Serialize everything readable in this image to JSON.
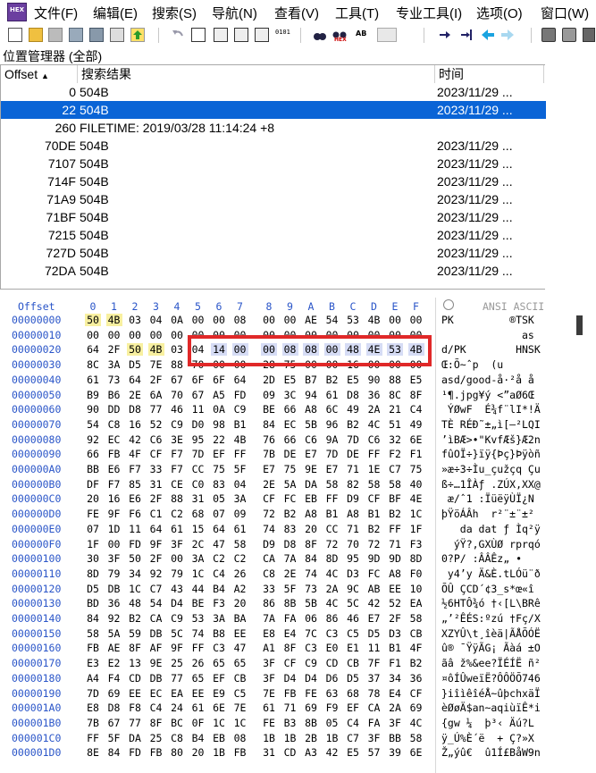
{
  "menu": {
    "items": [
      "文件(F)",
      "编辑(E)",
      "搜索(S)",
      "导航(N)",
      "查看(V)",
      "工具(T)",
      "专业工具(I)",
      "选项(O)",
      "窗口(W)"
    ]
  },
  "toolbar": {
    "icons": [
      "new-file-icon",
      "open-folder-icon",
      "save-icon",
      "print-icon",
      "print-preview-icon",
      "properties-icon",
      "export-icon",
      "undo-icon",
      "copy-icon",
      "copy-block-icon",
      "paste-icon",
      "paste-write-icon",
      "binary-icon",
      "find-icon",
      "find-hex-icon",
      "replace-icon",
      "find-hex-next-icon",
      "goto-icon",
      "goto-offset-icon",
      "back-icon",
      "forward-icon",
      "disk-icon",
      "disk-write-icon",
      "tool-icon"
    ],
    "labels": {
      "hex1": "HEX",
      "hex2": "HEX",
      "ab": "AB",
      "bin": "0101"
    }
  },
  "position_manager": {
    "title": "位置管理器 (全部)",
    "columns": {
      "offset": "Offset",
      "result": "搜索结果",
      "time": "时间"
    },
    "sort_arrow": "▲",
    "rows": [
      {
        "offset": "0",
        "result": "504B",
        "time": "2023/11/29 ..."
      },
      {
        "offset": "22",
        "result": "504B",
        "time": "2023/11/29 ..."
      },
      {
        "offset": "260",
        "result": "FILETIME: 2019/03/28  11:14:24  +8",
        "time": ""
      },
      {
        "offset": "70DE",
        "result": "504B",
        "time": "2023/11/29 ..."
      },
      {
        "offset": "7107",
        "result": "504B",
        "time": "2023/11/29 ..."
      },
      {
        "offset": "714F",
        "result": "504B",
        "time": "2023/11/29 ..."
      },
      {
        "offset": "71A9",
        "result": "504B",
        "time": "2023/11/29 ..."
      },
      {
        "offset": "71BF",
        "result": "504B",
        "time": "2023/11/29 ..."
      },
      {
        "offset": "7215",
        "result": "504B",
        "time": "2023/11/29 ..."
      },
      {
        "offset": "727D",
        "result": "504B",
        "time": "2023/11/29 ..."
      },
      {
        "offset": "72DA",
        "result": "504B",
        "time": "2023/11/29 ..."
      }
    ],
    "selected_row": 1
  },
  "hex": {
    "offset_header": "Offset",
    "column_headers": [
      "0",
      "1",
      "2",
      "3",
      "4",
      "5",
      "6",
      "7",
      "8",
      "9",
      "A",
      "B",
      "C",
      "D",
      "E",
      "F"
    ],
    "ansi_header": "ANSI ASCII",
    "rows": [
      {
        "offset": "00000000",
        "bytes": [
          "50",
          "4B",
          "03",
          "04",
          "0A",
          "00",
          "00",
          "08",
          "00",
          "00",
          "AE",
          "54",
          "53",
          "4B",
          "00",
          "00"
        ],
        "ansi": "PK         ®TSK"
      },
      {
        "offset": "00000010",
        "bytes": [
          "00",
          "00",
          "00",
          "00",
          "00",
          "00",
          "00",
          "00",
          "00",
          "00",
          "00",
          "00",
          "00",
          "00",
          "00",
          "00"
        ],
        "ansi": "             as"
      },
      {
        "offset": "00000020",
        "bytes": [
          "64",
          "2F",
          "50",
          "4B",
          "03",
          "04",
          "14",
          "00",
          "00",
          "08",
          "08",
          "00",
          "48",
          "4E",
          "53",
          "4B"
        ],
        "ansi": "d/PK        HNSK"
      },
      {
        "offset": "00000030",
        "bytes": [
          "8C",
          "3A",
          "D5",
          "7E",
          "88",
          "70",
          "00",
          "00",
          "28",
          "75",
          "00",
          "00",
          "16",
          "00",
          "00",
          "00"
        ],
        "ansi": "Œ:Õ~ˆp  (u"
      },
      {
        "offset": "00000040",
        "bytes": [
          "61",
          "73",
          "64",
          "2F",
          "67",
          "6F",
          "6F",
          "64",
          "2D",
          "E5",
          "B7",
          "B2",
          "E5",
          "90",
          "88",
          "E5"
        ],
        "ansi": "asd/good-å·²å å"
      },
      {
        "offset": "00000050",
        "bytes": [
          "B9",
          "B6",
          "2E",
          "6A",
          "70",
          "67",
          "A5",
          "FD",
          "09",
          "3C",
          "94",
          "61",
          "D8",
          "36",
          "8C",
          "8F"
        ],
        "ansi": "¹¶.jpg¥ý <”aØ6Œ"
      },
      {
        "offset": "00000060",
        "bytes": [
          "90",
          "DD",
          "D8",
          "77",
          "46",
          "11",
          "0A",
          "C9",
          "BE",
          "66",
          "A8",
          "6C",
          "49",
          "2A",
          "21",
          "C4"
        ],
        "ansi": " ÝØwF  É¾f¨lI*!Ä"
      },
      {
        "offset": "00000070",
        "bytes": [
          "54",
          "C8",
          "16",
          "52",
          "C9",
          "D0",
          "98",
          "B1",
          "84",
          "EC",
          "5B",
          "96",
          "B2",
          "4C",
          "51",
          "49"
        ],
        "ansi": "TÈ RÉÐ˜±„ì[–²LQI"
      },
      {
        "offset": "00000080",
        "bytes": [
          "92",
          "EC",
          "42",
          "C6",
          "3E",
          "95",
          "22",
          "4B",
          "76",
          "66",
          "C6",
          "9A",
          "7D",
          "C6",
          "32",
          "6E"
        ],
        "ansi": "’ìBÆ>•\"KvfÆš}Æ2n"
      },
      {
        "offset": "00000090",
        "bytes": [
          "66",
          "FB",
          "4F",
          "CF",
          "F7",
          "7D",
          "EF",
          "FF",
          "7B",
          "DE",
          "E7",
          "7D",
          "DE",
          "FF",
          "F2",
          "F1"
        ],
        "ansi": "fûOÏ÷}ïÿ{Þç}Þÿòñ"
      },
      {
        "offset": "000000A0",
        "bytes": [
          "BB",
          "E6",
          "F7",
          "33",
          "F7",
          "CC",
          "75",
          "5F",
          "E7",
          "75",
          "9E",
          "E7",
          "71",
          "1E",
          "C7",
          "75"
        ],
        "ansi": "»æ÷3÷Ìu_çužçq Çu"
      },
      {
        "offset": "000000B0",
        "bytes": [
          "DF",
          "F7",
          "85",
          "31",
          "CE",
          "C0",
          "83",
          "04",
          "2E",
          "5A",
          "DA",
          "58",
          "82",
          "58",
          "58",
          "40"
        ],
        "ansi": "ß÷…1ÎÀƒ .ZÚX‚XX@"
      },
      {
        "offset": "000000C0",
        "bytes": [
          "20",
          "16",
          "E6",
          "2F",
          "88",
          "31",
          "05",
          "3A",
          "CF",
          "FC",
          "EB",
          "FF",
          "D9",
          "CF",
          "BF",
          "4E"
        ],
        "ansi": " æ/ˆ1 :ÏüëÿÙÏ¿N"
      },
      {
        "offset": "000000D0",
        "bytes": [
          "FE",
          "9F",
          "F6",
          "C1",
          "C2",
          "68",
          "07",
          "09",
          "72",
          "B2",
          "A8",
          "B1",
          "A8",
          "B1",
          "B2",
          "1C"
        ],
        "ansi": "þŸöÁÂh  r²¨±¨±² "
      },
      {
        "offset": "000000E0",
        "bytes": [
          "07",
          "1D",
          "11",
          "64",
          "61",
          "15",
          "64",
          "61",
          "74",
          "83",
          "20",
          "CC",
          "71",
          "B2",
          "FF",
          "1F"
        ],
        "ansi": "   da dat ƒ Ìq²ÿ "
      },
      {
        "offset": "000000F0",
        "bytes": [
          "1F",
          "00",
          "FD",
          "9F",
          "3F",
          "2C",
          "47",
          "58",
          "D9",
          "D8",
          "8F",
          "72",
          "70",
          "72",
          "71",
          "F3"
        ],
        "ansi": "  ýŸ?,GXÙØ rprqó"
      },
      {
        "offset": "00000100",
        "bytes": [
          "30",
          "3F",
          "50",
          "2F",
          "00",
          "3A",
          "C2",
          "C2",
          "CA",
          "7A",
          "84",
          "8D",
          "95",
          "9D",
          "9D",
          "8D"
        ],
        "ansi": "0?P/ :ÂÂÊz„ •  "
      },
      {
        "offset": "00000110",
        "bytes": [
          "8D",
          "79",
          "34",
          "92",
          "79",
          "1C",
          "C4",
          "26",
          "C8",
          "2E",
          "74",
          "4C",
          "D3",
          "FC",
          "A8",
          "F0"
        ],
        "ansi": " y4’y Ä&È.tLÓü¨ð"
      },
      {
        "offset": "00000120",
        "bytes": [
          "D5",
          "DB",
          "1C",
          "C7",
          "43",
          "44",
          "B4",
          "A2",
          "33",
          "5F",
          "73",
          "2A",
          "9C",
          "AB",
          "EE",
          "10"
        ],
        "ansi": "ÕÛ ÇCD´¢3_s*œ«î "
      },
      {
        "offset": "00000130",
        "bytes": [
          "BD",
          "36",
          "48",
          "54",
          "D4",
          "BE",
          "F3",
          "20",
          "86",
          "8B",
          "5B",
          "4C",
          "5C",
          "42",
          "52",
          "EA"
        ],
        "ansi": "½6HTÔ¾ó †‹[L\\BRê"
      },
      {
        "offset": "00000140",
        "bytes": [
          "84",
          "92",
          "B2",
          "CA",
          "C9",
          "53",
          "3A",
          "BA",
          "7A",
          "FA",
          "06",
          "86",
          "46",
          "E7",
          "2F",
          "58"
        ],
        "ansi": "„’²ÊÉS:ºzú †Fç/X"
      },
      {
        "offset": "00000150",
        "bytes": [
          "58",
          "5A",
          "59",
          "DB",
          "5C",
          "74",
          "B8",
          "EE",
          "E8",
          "E4",
          "7C",
          "C3",
          "C5",
          "D5",
          "D3",
          "CB"
        ],
        "ansi": "XZYÛ\\t¸îèä|ÃÅÕÓË"
      },
      {
        "offset": "00000160",
        "bytes": [
          "FB",
          "AE",
          "8F",
          "AF",
          "9F",
          "FF",
          "C3",
          "47",
          "A1",
          "8F",
          "C3",
          "E0",
          "E1",
          "11",
          "B1",
          "4F"
        ],
        "ansi": "û® ¯ŸÿÃG¡ Ãàá ±O"
      },
      {
        "offset": "00000170",
        "bytes": [
          "E3",
          "E2",
          "13",
          "9E",
          "25",
          "26",
          "65",
          "65",
          "3F",
          "CF",
          "C9",
          "CD",
          "CB",
          "7F",
          "F1",
          "B2"
        ],
        "ansi": "ãâ ž%&ee?ÏÉÍË ñ²"
      },
      {
        "offset": "00000180",
        "bytes": [
          "A4",
          "F4",
          "CD",
          "DB",
          "77",
          "65",
          "EF",
          "CB",
          "3F",
          "D4",
          "D4",
          "D6",
          "D5",
          "37",
          "34",
          "36"
        ],
        "ansi": "¤ôÍÛweïË?ÔÔÖÕ746"
      },
      {
        "offset": "00000190",
        "bytes": [
          "7D",
          "69",
          "EE",
          "EC",
          "EA",
          "EE",
          "E9",
          "C5",
          "7E",
          "FB",
          "FE",
          "63",
          "68",
          "78",
          "E4",
          "CF"
        ],
        "ansi": "}iîìêîéÅ~ûþchxäÏ"
      },
      {
        "offset": "000001A0",
        "bytes": [
          "E8",
          "D8",
          "F8",
          "C4",
          "24",
          "61",
          "6E",
          "7E",
          "61",
          "71",
          "69",
          "F9",
          "EF",
          "CA",
          "2A",
          "69"
        ],
        "ansi": "èØøÄ$an~aqiùïÊ*i"
      },
      {
        "offset": "000001B0",
        "bytes": [
          "7B",
          "67",
          "77",
          "8F",
          "BC",
          "0F",
          "1C",
          "1C",
          "FE",
          "B3",
          "8B",
          "05",
          "C4",
          "FA",
          "3F",
          "4C"
        ],
        "ansi": "{gw ¼  þ³‹ Äú?L"
      },
      {
        "offset": "000001C0",
        "bytes": [
          "FF",
          "5F",
          "DA",
          "25",
          "C8",
          "B4",
          "EB",
          "08",
          "1B",
          "1B",
          "2B",
          "1B",
          "C7",
          "3F",
          "BB",
          "58"
        ],
        "ansi": "ÿ_Ú%È´ë  + Ç?»X"
      },
      {
        "offset": "000001D0",
        "bytes": [
          "8E",
          "84",
          "FD",
          "FB",
          "80",
          "20",
          "1B",
          "FB",
          "31",
          "CD",
          "A3",
          "42",
          "E5",
          "57",
          "39",
          "6E"
        ],
        "ansi": "Ž„ýû€  û1Í£BåW9n"
      }
    ]
  }
}
